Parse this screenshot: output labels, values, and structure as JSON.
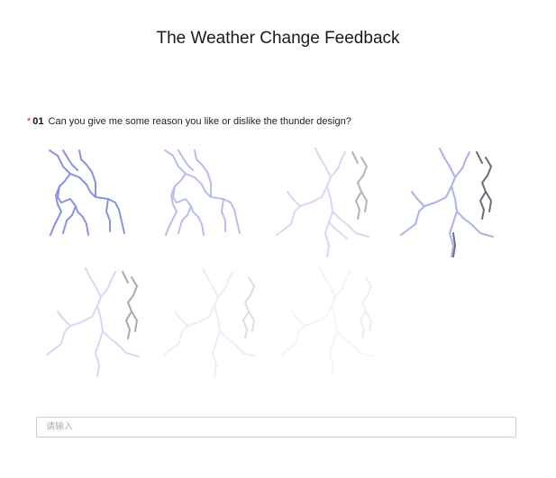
{
  "page": {
    "title": "The Weather Change Feedback"
  },
  "question": {
    "required_marker": "*",
    "number": "01",
    "text": "Can you give me some reason you like or dislike the thunder design?"
  },
  "answer": {
    "placeholder": "请输入",
    "value": ""
  },
  "lightning_frames": [
    {
      "frame": 1,
      "opacity": 1.0,
      "style": "left-bolt"
    },
    {
      "frame": 2,
      "opacity": 0.6,
      "style": "left-bolt"
    },
    {
      "frame": 3,
      "opacity": 0.55,
      "style": "split-bolt"
    },
    {
      "frame": 4,
      "opacity": 1.0,
      "style": "split-bolt"
    },
    {
      "frame": 5,
      "opacity": 0.5,
      "style": "split-bolt"
    },
    {
      "frame": 6,
      "opacity": 0.22,
      "style": "split-bolt"
    },
    {
      "frame": 7,
      "opacity": 0.15,
      "style": "split-bolt"
    }
  ],
  "colors": {
    "bolt_blue": "#8a93e0",
    "bolt_light": "#c7ccf3",
    "bolt_gray": "#6c6c7a",
    "required": "#e02020"
  }
}
